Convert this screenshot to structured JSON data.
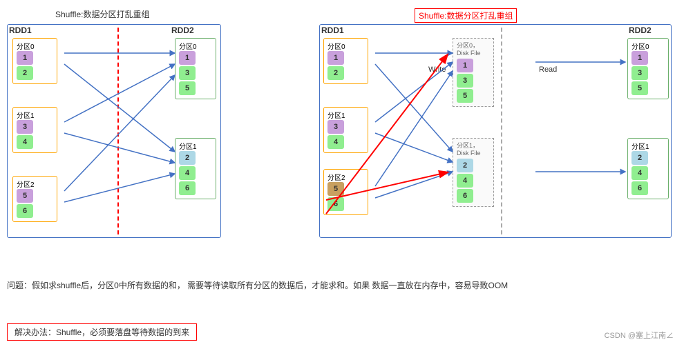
{
  "left_diagram": {
    "title": "RDD1",
    "shuffle_label": "Shuffle:数据分区打乱重组",
    "rdd2_title": "RDD2",
    "partitions_rdd1": [
      {
        "label": "分区0",
        "cells": [
          {
            "val": "1",
            "color": "purple"
          },
          {
            "val": "2",
            "color": "green"
          }
        ],
        "border": "#FFA500"
      },
      {
        "label": "分区1",
        "cells": [
          {
            "val": "3",
            "color": "purple"
          },
          {
            "val": "4",
            "color": "green"
          }
        ],
        "border": "#FFA500"
      },
      {
        "label": "分区2",
        "cells": [
          {
            "val": "5",
            "color": "purple"
          },
          {
            "val": "6",
            "color": "green"
          }
        ],
        "border": "#FFA500"
      }
    ],
    "partitions_rdd2": [
      {
        "label": "分区0",
        "cells": [
          {
            "val": "1",
            "color": "purple"
          },
          {
            "val": "3",
            "color": "green"
          },
          {
            "val": "5",
            "color": "green"
          }
        ],
        "border": "#6AAF6A"
      },
      {
        "label": "分区1",
        "cells": [
          {
            "val": "2",
            "color": "blue"
          },
          {
            "val": "4",
            "color": "green"
          },
          {
            "val": "6",
            "color": "green"
          }
        ],
        "border": "#6AAF6A"
      }
    ]
  },
  "right_diagram": {
    "rdd1_title": "RDD1",
    "shuffle_label": "Shuffle:数据分区打乱重组",
    "rdd2_title": "RDD2",
    "write_label": "Write",
    "read_label": "Read",
    "disk0_label": "分区0，Disk File",
    "disk1_label": "分区1，Disk File",
    "partitions_rdd1": [
      {
        "label": "分区0",
        "cells": [
          {
            "val": "1",
            "color": "purple"
          },
          {
            "val": "2",
            "color": "green"
          }
        ],
        "border": "#FFA500"
      },
      {
        "label": "分区1",
        "cells": [
          {
            "val": "3",
            "color": "purple"
          },
          {
            "val": "4",
            "color": "green"
          }
        ],
        "border": "#FFA500"
      },
      {
        "label": "分区2",
        "cells": [
          {
            "val": "5",
            "color": "purple"
          },
          {
            "val": "6",
            "color": "green"
          }
        ],
        "border": "#FFA500"
      }
    ],
    "disk0_cells": [
      {
        "val": "1",
        "color": "purple"
      },
      {
        "val": "3",
        "color": "green"
      },
      {
        "val": "5",
        "color": "green"
      }
    ],
    "disk1_cells": [
      {
        "val": "2",
        "color": "blue"
      },
      {
        "val": "4",
        "color": "green"
      },
      {
        "val": "6",
        "color": "green"
      }
    ],
    "partitions_rdd2": [
      {
        "label": "分区0",
        "cells": [
          {
            "val": "1",
            "color": "purple"
          },
          {
            "val": "3",
            "color": "green"
          },
          {
            "val": "5",
            "color": "green"
          }
        ],
        "border": "#6AAF6A"
      },
      {
        "label": "分区1",
        "cells": [
          {
            "val": "2",
            "color": "blue"
          },
          {
            "val": "4",
            "color": "green"
          },
          {
            "val": "6",
            "color": "green"
          }
        ],
        "border": "#6AAF6A"
      }
    ]
  },
  "bottom": {
    "question": "问题：假如求shuffle后，分区0中所有数据的和，\n需要等待读取所有分区的数据后，才能求和。如果\n数据一直放在内存中，容易导致OOM",
    "solution": "解决办法：Shuffle，必须要落盘等待数据的到来",
    "watermark": "CSDN @塞上江南∠"
  }
}
